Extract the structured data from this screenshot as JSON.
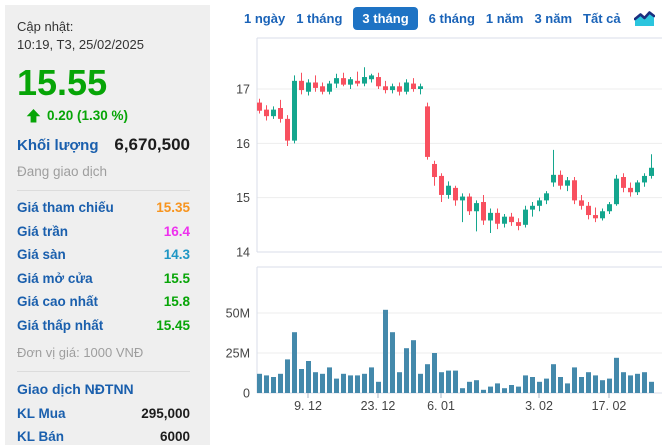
{
  "left_panel": {
    "updated_label": "Cập nhật:",
    "updated_time": "10:19, T3, 25/02/2025",
    "price": "15.55",
    "change": "0.20 (1.30 %)",
    "volume_label": "Khối lượng",
    "volume_value": "6,670,500",
    "status": "Đang giao dịch",
    "stats": [
      {
        "label": "Giá tham chiếu",
        "value": "15.35",
        "color": "#F7941E"
      },
      {
        "label": "Giá trần",
        "value": "16.4",
        "color": "#EE30EE"
      },
      {
        "label": "Giá sàn",
        "value": "14.3",
        "color": "#1E96C4"
      },
      {
        "label": "Giá mở cửa",
        "value": "15.5",
        "color": "#07A507"
      },
      {
        "label": "Giá cao nhất",
        "value": "15.8",
        "color": "#07A507"
      },
      {
        "label": "Giá thấp nhất",
        "value": "15.45",
        "color": "#07A507"
      }
    ],
    "unit_note": "Đơn vị giá: 1000 VNĐ",
    "foreign_header": "Giao dịch NĐTNN",
    "foreign_rows": [
      {
        "label": "KL Mua",
        "value": "295,000"
      },
      {
        "label": "KL Bán",
        "value": "6000"
      }
    ]
  },
  "tabs": {
    "items": [
      "1 ngày",
      "1 tháng",
      "3 tháng",
      "6 tháng",
      "1 năm",
      "3 năm",
      "Tất cả"
    ],
    "active": "3 tháng",
    "active_index": 2
  },
  "chart_data": {
    "type": "candlestick",
    "title": "",
    "price_axis": {
      "tick_labels": [
        "17",
        "16",
        "15",
        "14"
      ],
      "ticks": [
        17,
        16,
        15,
        14
      ],
      "ylim": [
        13.9,
        17.9
      ]
    },
    "volume_axis": {
      "ticks": [
        {
          "v": 50,
          "label": "50M"
        },
        {
          "v": 25,
          "label": "25M"
        },
        {
          "v": 0,
          "label": "0"
        }
      ],
      "unit": "millions",
      "ylim": [
        0,
        79
      ]
    },
    "x_ticks": [
      {
        "index": 7,
        "label": "9. 12"
      },
      {
        "index": 17,
        "label": "23. 12"
      },
      {
        "index": 26,
        "label": "6. 01"
      },
      {
        "index": 40,
        "label": "3. 02"
      },
      {
        "index": 50,
        "label": "17. 02"
      }
    ],
    "candles_ohlc": [
      [
        16.75,
        16.82,
        16.55,
        16.6
      ],
      [
        16.62,
        16.7,
        16.42,
        16.5
      ],
      [
        16.5,
        16.68,
        16.45,
        16.62
      ],
      [
        16.65,
        16.8,
        16.38,
        16.45
      ],
      [
        16.45,
        16.52,
        15.95,
        16.05
      ],
      [
        16.05,
        17.25,
        16.0,
        17.15
      ],
      [
        17.15,
        17.3,
        16.9,
        16.98
      ],
      [
        16.95,
        17.18,
        16.88,
        17.12
      ],
      [
        17.12,
        17.25,
        16.95,
        17.02
      ],
      [
        17.05,
        17.12,
        16.9,
        16.95
      ],
      [
        16.95,
        17.15,
        16.9,
        17.1
      ],
      [
        17.1,
        17.28,
        17.02,
        17.2
      ],
      [
        17.2,
        17.3,
        17.05,
        17.08
      ],
      [
        17.08,
        17.22,
        17.0,
        17.18
      ],
      [
        17.15,
        17.32,
        17.05,
        17.1
      ],
      [
        17.1,
        17.4,
        17.05,
        17.22
      ],
      [
        17.18,
        17.28,
        17.12,
        17.25
      ],
      [
        17.22,
        17.3,
        17.0,
        17.05
      ],
      [
        17.05,
        17.15,
        16.92,
        16.98
      ],
      [
        16.98,
        17.1,
        16.92,
        17.05
      ],
      [
        17.05,
        17.12,
        16.88,
        16.95
      ],
      [
        16.95,
        17.18,
        16.9,
        17.12
      ],
      [
        17.1,
        17.2,
        16.95,
        17.0
      ],
      [
        17.0,
        17.1,
        16.9,
        17.05
      ],
      [
        16.68,
        16.75,
        15.7,
        15.75
      ],
      [
        15.62,
        15.68,
        15.22,
        15.38
      ],
      [
        15.4,
        15.45,
        14.92,
        15.05
      ],
      [
        15.05,
        15.3,
        14.98,
        15.22
      ],
      [
        15.18,
        15.22,
        14.85,
        14.95
      ],
      [
        14.95,
        15.08,
        14.55,
        15.02
      ],
      [
        15.02,
        15.08,
        14.68,
        14.75
      ],
      [
        14.75,
        14.95,
        14.38,
        14.9
      ],
      [
        14.92,
        15.05,
        14.5,
        14.58
      ],
      [
        14.58,
        14.8,
        14.35,
        14.72
      ],
      [
        14.72,
        14.8,
        14.42,
        14.52
      ],
      [
        14.52,
        14.7,
        14.45,
        14.65
      ],
      [
        14.65,
        14.72,
        14.48,
        14.55
      ],
      [
        14.55,
        14.62,
        14.4,
        14.48
      ],
      [
        14.5,
        14.85,
        14.45,
        14.78
      ],
      [
        14.78,
        14.92,
        14.65,
        14.85
      ],
      [
        14.85,
        15.0,
        14.75,
        14.95
      ],
      [
        14.95,
        15.12,
        14.88,
        15.08
      ],
      [
        15.28,
        15.88,
        15.2,
        15.42
      ],
      [
        15.42,
        15.5,
        15.15,
        15.22
      ],
      [
        15.22,
        15.38,
        15.12,
        15.32
      ],
      [
        15.32,
        15.38,
        14.88,
        14.95
      ],
      [
        14.95,
        15.05,
        14.78,
        14.85
      ],
      [
        14.85,
        14.92,
        14.6,
        14.68
      ],
      [
        14.68,
        14.82,
        14.55,
        14.62
      ],
      [
        14.62,
        14.8,
        14.58,
        14.75
      ],
      [
        14.75,
        14.92,
        14.7,
        14.88
      ],
      [
        14.88,
        15.42,
        14.85,
        15.35
      ],
      [
        15.38,
        15.45,
        15.1,
        15.18
      ],
      [
        15.18,
        15.28,
        15.02,
        15.1
      ],
      [
        15.1,
        15.32,
        15.05,
        15.28
      ],
      [
        15.28,
        15.45,
        15.2,
        15.4
      ],
      [
        15.4,
        15.8,
        15.35,
        15.55
      ]
    ],
    "volumes_millions": [
      12,
      11,
      10,
      12,
      21,
      38,
      15,
      20,
      13,
      12,
      16,
      9,
      12,
      11,
      11,
      12,
      16,
      7,
      52,
      38,
      13,
      28,
      33,
      12,
      18,
      25,
      13,
      14,
      14,
      3,
      7,
      8,
      2,
      4,
      6,
      3,
      5,
      4,
      11,
      10,
      7,
      9,
      18,
      10,
      6,
      16,
      10,
      13,
      11,
      8,
      9,
      22,
      13,
      11,
      12,
      13,
      7
    ],
    "colors": {
      "up": "#14A68E",
      "down": "#F8505F",
      "volume": "#4489AB",
      "grid": "#EDEDED",
      "pane_border": "#D8DEE9",
      "tick_mark": "#AAB4C4",
      "axis_text": "#444444"
    }
  }
}
